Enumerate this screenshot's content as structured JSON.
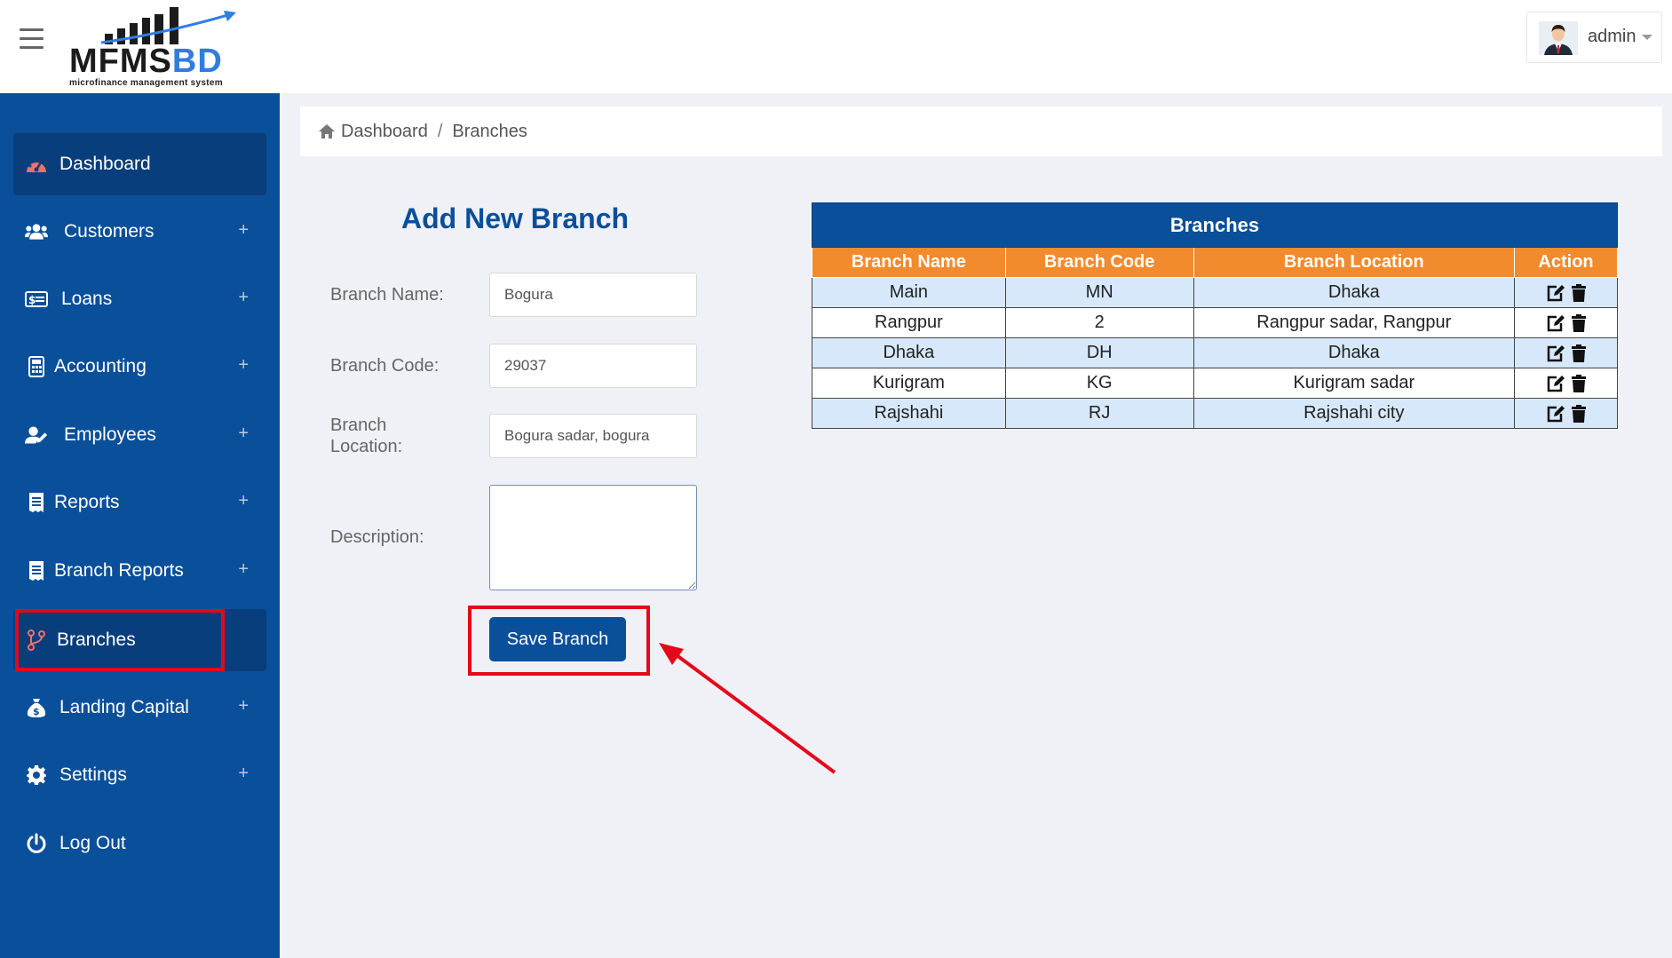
{
  "header": {
    "logo_main": "MFMS",
    "logo_accent": "BD",
    "logo_subtitle": "microfinance management system",
    "user_name": "admin"
  },
  "sidebar": {
    "items": [
      {
        "label": "Dashboard",
        "icon": "dashboard-icon",
        "expandable": false,
        "active": true
      },
      {
        "label": "Customers",
        "icon": "users-icon",
        "expandable": true
      },
      {
        "label": "Loans",
        "icon": "money-card-icon",
        "expandable": true
      },
      {
        "label": "Accounting",
        "icon": "calculator-icon",
        "expandable": true
      },
      {
        "label": "Employees",
        "icon": "user-edit-icon",
        "expandable": true
      },
      {
        "label": "Reports",
        "icon": "receipt-icon",
        "expandable": true
      },
      {
        "label": "Branch Reports",
        "icon": "receipt-icon",
        "expandable": true
      },
      {
        "label": "Branches",
        "icon": "branch-icon",
        "expandable": false,
        "active": true,
        "highlighted": true
      },
      {
        "label": "Landing Capital",
        "icon": "money-bag-icon",
        "expandable": true
      },
      {
        "label": "Settings",
        "icon": "gear-icon",
        "expandable": true
      },
      {
        "label": "Log Out",
        "icon": "power-icon",
        "expandable": false
      }
    ],
    "plus_symbol": "+"
  },
  "breadcrumb": {
    "home": "Dashboard",
    "separator": "/",
    "current": "Branches"
  },
  "form": {
    "title": "Add New Branch",
    "branch_name_label": "Branch Name:",
    "branch_name_value": "Bogura",
    "branch_code_label": "Branch Code:",
    "branch_code_value": "29037",
    "branch_location_label_line1": "Branch",
    "branch_location_label_line2": "Location:",
    "branch_location_value": "Bogura sadar, bogura",
    "description_label": "Description:",
    "description_value": "",
    "save_label": "Save Branch"
  },
  "table": {
    "title": "Branches",
    "columns": [
      "Branch Name",
      "Branch Code",
      "Branch Location",
      "Action"
    ],
    "rows": [
      [
        "Main",
        "MN",
        "Dhaka"
      ],
      [
        "Rangpur",
        "2",
        "Rangpur sadar, Rangpur"
      ],
      [
        "Dhaka",
        "DH",
        "Dhaka"
      ],
      [
        "Kurigram",
        "KG",
        "Kurigram sadar"
      ],
      [
        "Rajshahi",
        "RJ",
        "Rajshahi city"
      ]
    ]
  },
  "colors": {
    "primary": "#0a4f9a",
    "sidebar_active": "#083e7c",
    "table_header": "#f28a2e",
    "row_alt": "#d6e8fa",
    "annotation_red": "#e4081a",
    "dashboard_icon": "#f0706a"
  }
}
